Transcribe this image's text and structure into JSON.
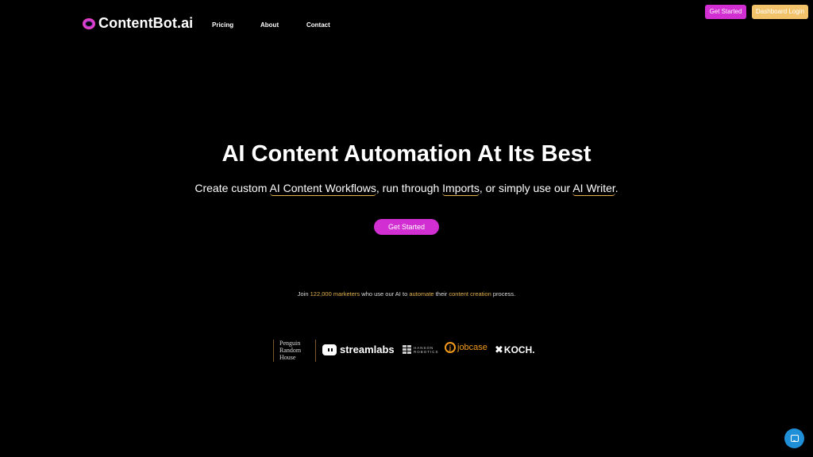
{
  "nav": {
    "logo_text": "ContentBot.ai",
    "links": [
      "Pricing",
      "About",
      "Contact"
    ],
    "get_started_label": "Get Started",
    "dashboard_label": "Dashboard Login"
  },
  "hero": {
    "title": "AI Content Automation At Its Best",
    "sub_prefix": "Create custom",
    "sub_link1": "AI Content Workflows",
    "sub_mid1": ", run through",
    "sub_link2": "Imports",
    "sub_mid2": ", or simply use our",
    "sub_link3": "AI Writer",
    "sub_suffix": ".",
    "cta_label": "Get Started"
  },
  "join": {
    "prefix": "Join",
    "count": "122,000 marketers",
    "mid1": "who use our AI to",
    "automate": "automate",
    "mid2": "their",
    "content": "content creation",
    "suffix": "process."
  },
  "logos": {
    "penguin": [
      "Penguin",
      "Random",
      "House"
    ],
    "streamlabs": "streamlabs",
    "hanson": [
      "HANSON",
      "ROBOTICS"
    ],
    "jobcase": "jobcase",
    "koch": "KOCH."
  },
  "colors": {
    "accent_magenta": "#d22fd2",
    "accent_gold": "#e3b24d",
    "chat_blue": "#1f8fd8"
  }
}
